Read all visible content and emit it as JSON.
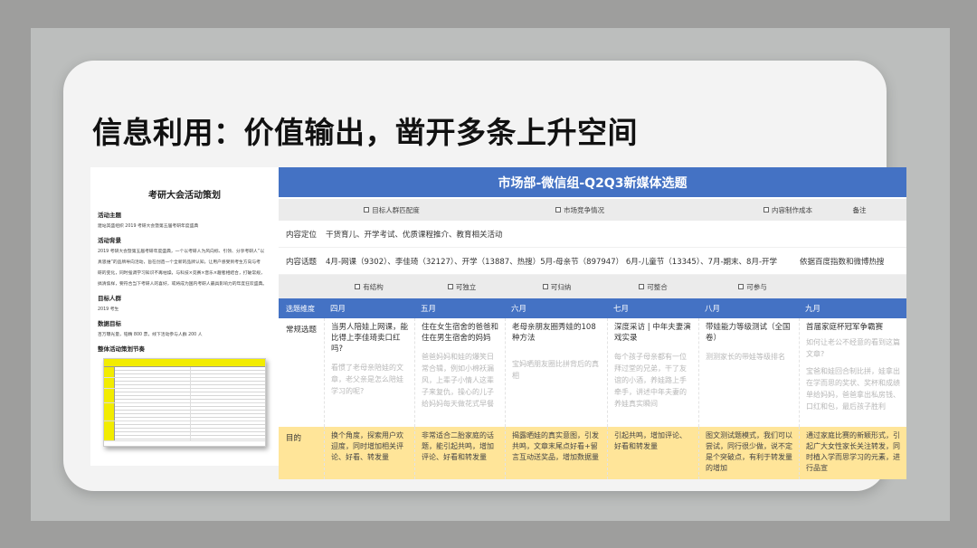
{
  "slide": {
    "title": "信息利用：价值输出，凿开多条上升空间"
  },
  "document": {
    "title": "考研大会活动策划",
    "sections": [
      {
        "heading": "活动主题",
        "lines": [
          "建站其盛组织 2019 考研大会暨第五届考研年度盛典"
        ]
      },
      {
        "heading": "活动背景",
        "lines": [
          "2019 考研大会暨第五届考研年度盛典，一个以考研人为风向标、引领、分享考研人“以",
          "真思维”的品牌导向活动，旨在创造一个全新的品牌认知，让用户感受到考生方向与考",
          "研的变化，同时强调学习知识不再枯燥，与科技×竞赛×音乐×趣者相结合，打破常规，",
          "搞清焦样，要符合当下考研人的喜好，或将成为国内考研人最具影响力的年度狂欢盛典。"
        ]
      },
      {
        "heading": "目标人群",
        "lines": [
          "2019 考生"
        ]
      },
      {
        "heading": "数据目标",
        "lines": [
          "百万曝光量，铂精 800 票，线下活动参与人群 200 人"
        ]
      },
      {
        "heading": "整体活动策划节奏",
        "lines": []
      }
    ]
  },
  "table": {
    "header": "市场部-微信组-Q2Q3新媒体选题",
    "criteria_row1": [
      "目标人群匹配度",
      "市场竞争情况",
      "内容制作成本"
    ],
    "remarks_label": "备注",
    "positioning": {
      "label": "内容定位",
      "value": "干货育儿、开学考试、优质课程推介、教育相关活动"
    },
    "hot_topics": {
      "label": "内容话题",
      "value": "4月-网课（9302）、李佳琦（32127）、开学（13887、热搜）5月-母亲节（897947） 6月-儿童节（13345）、7月-期末、8月-开学",
      "remark": "依据百度指数和微博热搜"
    },
    "criteria_row2": [
      "有结构",
      "可独立",
      "可归纳",
      "可整合",
      "可参与"
    ],
    "months_row": {
      "label": "选题维度",
      "months": [
        "四月",
        "五月",
        "六月",
        "七月",
        "八月",
        "九月"
      ]
    },
    "topics": {
      "label": "常规选题",
      "items": [
        {
          "title": "当男人陪娃上网课，能比得上李佳琦卖口红吗?",
          "sub": [
            "看惯了老母亲陪娃的文章，老父亲是怎么陪娃学习的呢?"
          ]
        },
        {
          "title": "住在女生宿舍的爸爸和住在男生宿舍的妈妈",
          "sub": [
            "爸爸妈妈和娃的爆笑日常合辑，例如小棉袄漏风，上辈子小情人这辈子来复仇，操心的儿子给妈妈每天做花式早餐"
          ]
        },
        {
          "title": "老母亲朋友圈秀娃的108种方法",
          "sub": [
            "宝妈晒朋友圈比拼背后的真相"
          ]
        },
        {
          "title": "深度采访 | 中年夫妻演戏实录",
          "sub": [
            "每个孩子母亲都有一位拜过堂的兄弟，干了友谊的小酒，养娃路上手牵手，讲述中年夫妻的养娃真实瞬间"
          ]
        },
        {
          "title": "带娃能力等级测试（全国卷）",
          "sub": [
            "测测家长的带娃等级排名"
          ]
        },
        {
          "title": "首届家庭杯冠军争霸赛",
          "sub": [
            "如何让老公不经意的看到这篇文章?",
            "宝爸和娃回合制比拼，娃拿出在学而思的奖状、奖杯和成绩单给妈妈，爸爸拿出私房钱、口红和包，最后孩子胜利"
          ]
        }
      ]
    },
    "purpose": {
      "label": "目的",
      "items": [
        "换个角度，探索用户欢迎度，同时增加相关评论、好看、转发量",
        "非常适合二胎家庭的话题，能引起共鸣，增加评论、好看和转发量",
        "揭露晒娃的真实意图，引发共鸣，文章末尾点好看+留言互动送奖品，增加数据量",
        "引起共鸣，增加评论、好看和转发量",
        "图文测试题模式，我们可以尝试，同行很少做，说不定是个突破点，有利于转发量的增加",
        "通过家庭比赛的新颖形式，引起广大女性家长关注转发，同时植入学而思学习的元素，进行品宣"
      ]
    }
  },
  "colors": {
    "header_blue": "#4472c4",
    "purpose_yellow": "#ffe599",
    "criteria_gray": "#ebebeb"
  }
}
